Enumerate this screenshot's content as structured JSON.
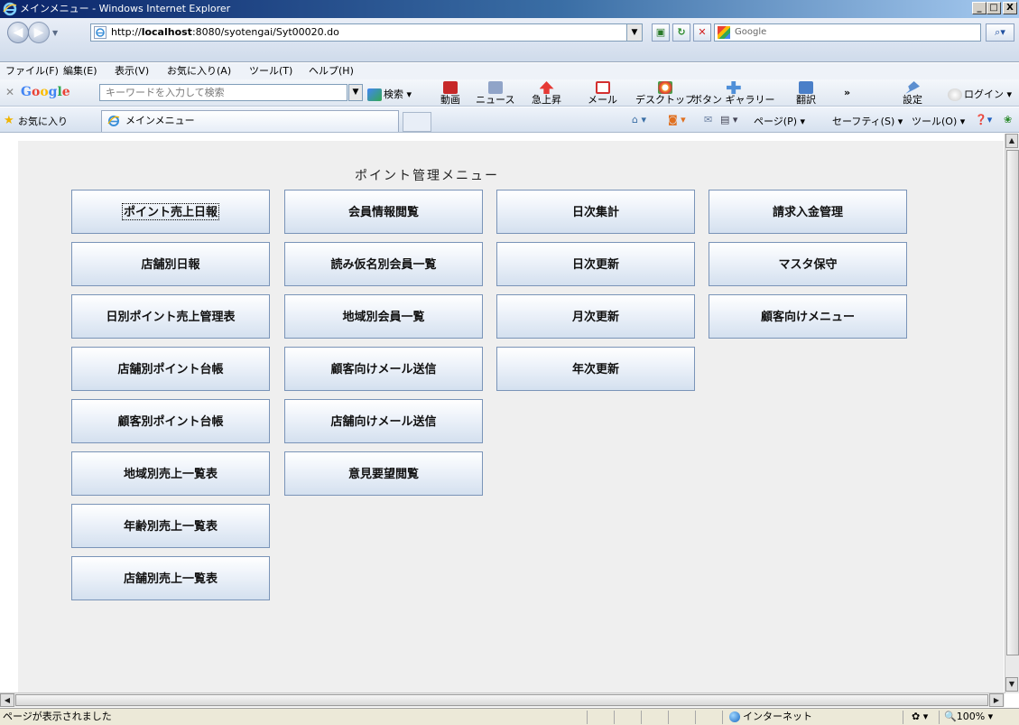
{
  "window": {
    "title": "メインメニュー - Windows Internet Explorer",
    "controls": {
      "minimize": "_",
      "maximize": "□",
      "close": "X"
    }
  },
  "address_bar": {
    "url_prefix": "http://",
    "url_host": "localhost",
    "url_rest": ":8080/syotengai/Syt00020.do",
    "search_engine": "Google"
  },
  "menu_bar": {
    "items": [
      "ファイル(F)",
      "編集(E)",
      "表示(V)",
      "お気に入り(A)",
      "ツール(T)",
      "ヘルプ(H)"
    ]
  },
  "google_toolbar": {
    "search_placeholder": "キーワードを入力して検索",
    "search_button": "検索",
    "video": "動画",
    "news": "ニュース",
    "trending": "急上昇",
    "mail": "メール",
    "desktop": "デスクトップ",
    "gallery": "ボタン ギャラリー",
    "translate": "翻訳",
    "more": "»",
    "settings": "設定",
    "login": "ログイン"
  },
  "favorites_bar": {
    "label": "お気に入り",
    "tab_title": "メインメニュー"
  },
  "command_bar": {
    "page": "ページ(P)",
    "safety": "セーフティ(S)",
    "tools": "ツール(O)"
  },
  "page": {
    "title": "ポイント管理メニュー",
    "columns": [
      [
        "ポイント売上日報",
        "店舗別日報",
        "日別ポイント売上管理表",
        "店舗別ポイント台帳",
        "顧客別ポイント台帳",
        "地域別売上一覧表",
        "年齢別売上一覧表",
        "店舗別売上一覧表"
      ],
      [
        "会員情報閲覧",
        "読み仮名別会員一覧",
        "地域別会員一覧",
        "顧客向けメール送信",
        "店舗向けメール送信",
        "意見要望閲覧"
      ],
      [
        "日次集計",
        "日次更新",
        "月次更新",
        "年次更新"
      ],
      [
        "請求入金管理",
        "マスタ保守",
        "顧客向けメニュー"
      ]
    ]
  },
  "status_bar": {
    "text": "ページが表示されました",
    "zone": "インターネット",
    "zoom": "100%"
  },
  "colors": {
    "button_top": "#ffffff",
    "button_bottom": "#d4e0ef",
    "button_border": "#7a94b8",
    "page_background": "#efefef"
  }
}
